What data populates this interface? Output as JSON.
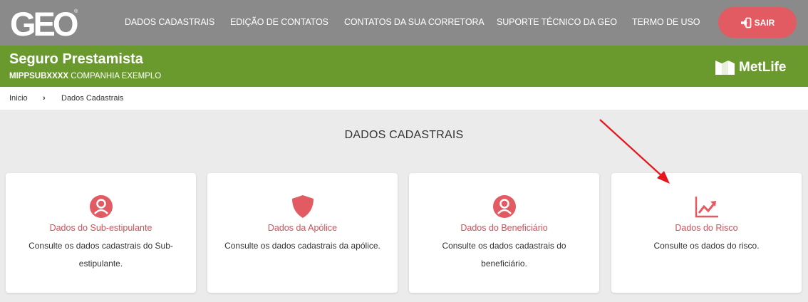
{
  "topbar": {
    "logo_text": "GEO",
    "nav": [
      "DADOS CADASTRAIS",
      "EDIÇÃO DE CONTATOS",
      "CONTATOS DA SUA CORRETORA",
      "SUPORTE TÉCNICO DA GEO",
      "TERMO DE USO"
    ],
    "logout_label": "SAIR"
  },
  "product": {
    "title": "Seguro Prestamista",
    "policy_code": "MIPPSUBXXXX",
    "company": "COMPANHIA EXEMPLO",
    "insurer": "MetLife"
  },
  "breadcrumb": {
    "home": "Inicio",
    "separator": "›",
    "current": "Dados Cadastrais"
  },
  "section_title": "DADOS CADASTRAIS",
  "cards": [
    {
      "icon": "user-circle-icon",
      "title": "Dados do Sub-estipulante",
      "desc": "Consulte os dados cadastrais do Sub-estipulante."
    },
    {
      "icon": "shield-icon",
      "title": "Dados da Apólice",
      "desc": "Consulte os dados cadastrais da apólice."
    },
    {
      "icon": "user-circle-icon",
      "title": "Dados do Beneficiário",
      "desc": "Consulte os dados cadastrais do beneficiário."
    },
    {
      "icon": "trend-chart-icon",
      "title": "Dados do Risco",
      "desc": "Consulte os dados do risco."
    }
  ],
  "colors": {
    "topbar": "#8a8a8a",
    "header_green": "#6a9a2e",
    "accent_red": "#e25a62",
    "card_title": "#e04a55",
    "annotation": "#e8141b"
  }
}
